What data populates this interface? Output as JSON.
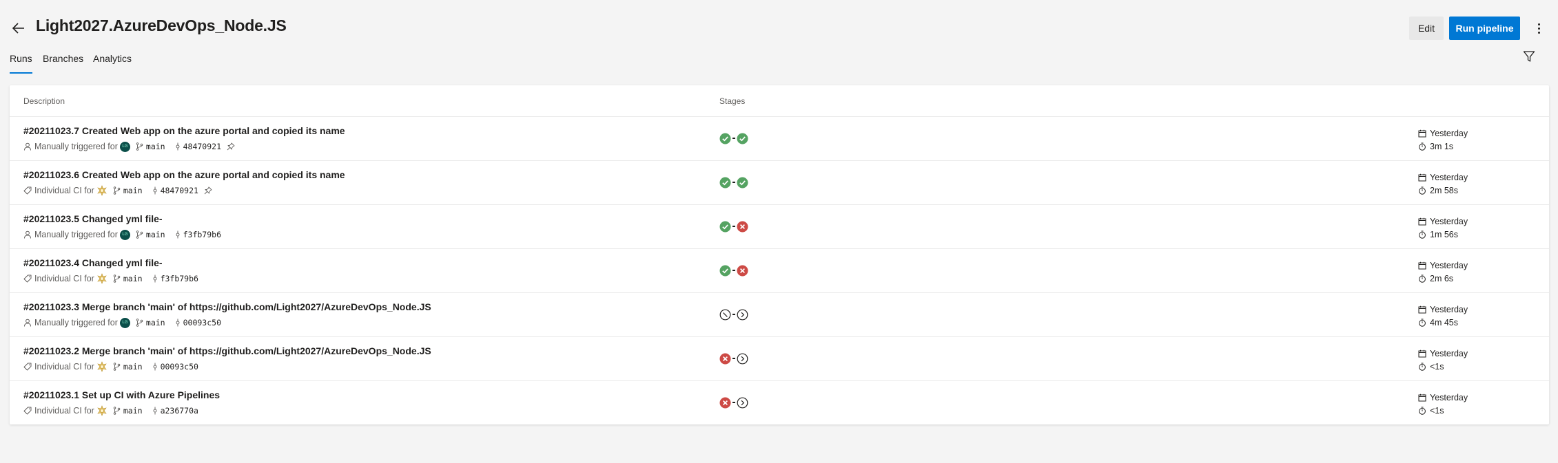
{
  "header": {
    "title": "Light2027.AzureDevOps_Node.JS",
    "edit_label": "Edit",
    "run_label": "Run pipeline"
  },
  "tabs": [
    {
      "label": "Runs",
      "active": true
    },
    {
      "label": "Branches",
      "active": false
    },
    {
      "label": "Analytics",
      "active": false
    }
  ],
  "table": {
    "col_description": "Description",
    "col_stages": "Stages"
  },
  "runs": [
    {
      "title": "#20211023.7 Created Web app on the azure portal and copied its name",
      "trigger_icon": "person-icon",
      "trigger": "Manually triggered for",
      "avatar": "user-avatar",
      "branch": "main",
      "commit": "48470921",
      "pinned": true,
      "stages": [
        "success",
        "success"
      ],
      "when": "Yesterday",
      "duration": "3m 1s"
    },
    {
      "title": "#20211023.6 Created Web app on the azure portal and copied its name",
      "trigger_icon": "tag-icon",
      "trigger": "Individual CI for",
      "avatar": "bot-avatar",
      "branch": "main",
      "commit": "48470921",
      "pinned": true,
      "stages": [
        "success",
        "success"
      ],
      "when": "Yesterday",
      "duration": "2m 58s"
    },
    {
      "title": "#20211023.5 Changed yml file-",
      "trigger_icon": "person-icon",
      "trigger": "Manually triggered for",
      "avatar": "user-avatar",
      "branch": "main",
      "commit": "f3fb79b6",
      "pinned": false,
      "stages": [
        "success",
        "failed"
      ],
      "when": "Yesterday",
      "duration": "1m 56s"
    },
    {
      "title": "#20211023.4 Changed yml file-",
      "trigger_icon": "tag-icon",
      "trigger": "Individual CI for",
      "avatar": "bot-avatar",
      "branch": "main",
      "commit": "f3fb79b6",
      "pinned": false,
      "stages": [
        "success",
        "failed"
      ],
      "when": "Yesterday",
      "duration": "2m 6s"
    },
    {
      "title": "#20211023.3 Merge branch 'main' of https://github.com/Light2027/AzureDevOps_Node.JS",
      "trigger_icon": "person-icon",
      "trigger": "Manually triggered for",
      "avatar": "user-avatar",
      "branch": "main",
      "commit": "00093c50",
      "pinned": false,
      "stages": [
        "canceled",
        "skipped"
      ],
      "when": "Yesterday",
      "duration": "4m 45s"
    },
    {
      "title": "#20211023.2 Merge branch 'main' of https://github.com/Light2027/AzureDevOps_Node.JS",
      "trigger_icon": "tag-icon",
      "trigger": "Individual CI for",
      "avatar": "bot-avatar",
      "branch": "main",
      "commit": "00093c50",
      "pinned": false,
      "stages": [
        "failed",
        "skipped"
      ],
      "when": "Yesterday",
      "duration": "<1s"
    },
    {
      "title": "#20211023.1 Set up CI with Azure Pipelines",
      "trigger_icon": "tag-icon",
      "trigger": "Individual CI for",
      "avatar": "bot-avatar",
      "branch": "main",
      "commit": "a236770a",
      "pinned": false,
      "stages": [
        "failed",
        "skipped"
      ],
      "when": "Yesterday",
      "duration": "<1s"
    }
  ],
  "colors": {
    "accent": "#0078d4",
    "success": "#55a362",
    "failed": "#cd4a45",
    "neutral": "#201f1e"
  }
}
